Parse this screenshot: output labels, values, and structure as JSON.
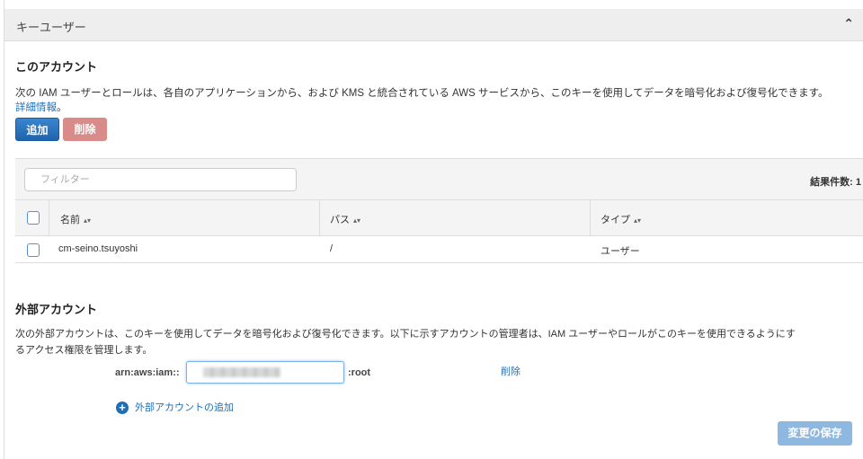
{
  "panel": {
    "title": "キーユーザー",
    "collapse_icon": "chevron-up-icon"
  },
  "this_account": {
    "title": "このアカウント",
    "description": "次の IAM ユーザーとロールは、各自のアプリケーションから、および KMS と統合されている AWS サービスから、このキーを使用してデータを暗号化および復号化できます。",
    "learn_more": "詳細情報",
    "learn_more_suffix": "。",
    "add_button": "追加",
    "delete_button": "削除",
    "filter_placeholder": "フィルター",
    "result_count": "結果件数: 1",
    "columns": [
      "名前",
      "パス",
      "タイプ"
    ],
    "rows": [
      {
        "name": "cm-seino.tsuyoshi",
        "path": "/",
        "type": "ユーザー"
      }
    ]
  },
  "external": {
    "title": "外部アカウント",
    "description_line1": "次の外部アカウントは、このキーを使用してデータを暗号化および復号化できます。以下に示すアカウントの管理者は、IAM ユーザーやロールがこのキーを使用できるようにす",
    "description_line2": "るアクセス権限を管理します。",
    "arn_prefix": "arn:aws:iam::",
    "arn_suffix": ":root",
    "delete_link": "削除",
    "add_link": "外部アカウントの追加",
    "save_button": "変更の保存"
  },
  "colors": {
    "primary": "#1f6fb5",
    "danger_disabled": "#d98b8a",
    "save_disabled": "#8fb8e0"
  }
}
